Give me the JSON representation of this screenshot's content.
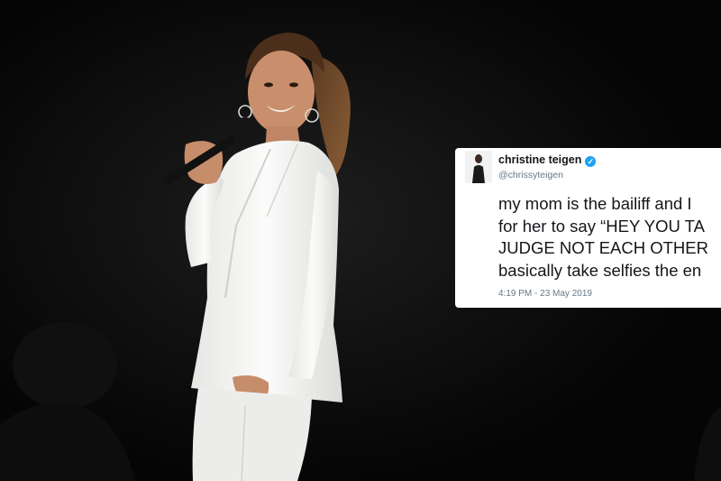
{
  "tweet": {
    "display_name": "christine teigen",
    "handle": "@chrissyteigen",
    "verified_icon": "verified-check-icon",
    "text_lines": [
      "my mom is the bailiff and I",
      "for her to say “HEY YOU TA",
      "JUDGE NOT EACH OTHER",
      "basically take selfies the en"
    ],
    "timestamp": "4:19 PM - 23 May 2019"
  },
  "colors": {
    "suit": "#f4f4f2",
    "verified": "#1da1f2",
    "background": "#060606"
  }
}
